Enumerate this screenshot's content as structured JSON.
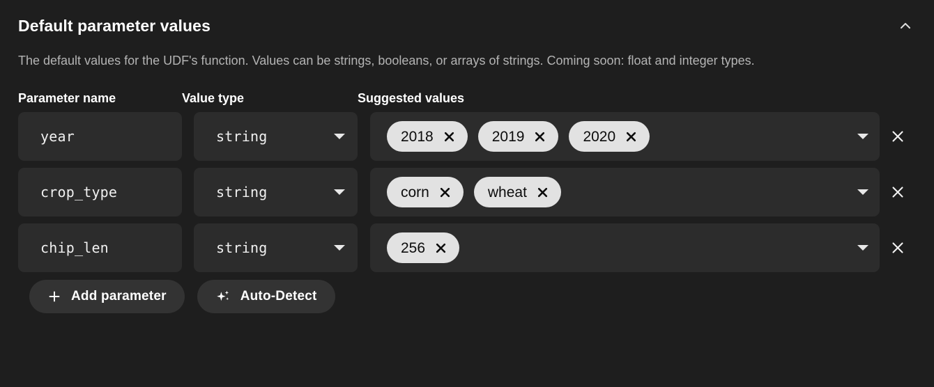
{
  "panel": {
    "title": "Default parameter values",
    "description": "The default values for the UDF's function. Values can be strings, booleans, or arrays of strings. Coming soon: float and integer types.",
    "collapse_icon": "chevron-up-icon"
  },
  "columns": {
    "parameter_name": "Parameter name",
    "value_type": "Value type",
    "suggested_values": "Suggested values"
  },
  "rows": [
    {
      "name": "year",
      "type": "string",
      "values": [
        "2018",
        "2019",
        "2020"
      ]
    },
    {
      "name": "crop_type",
      "type": "string",
      "values": [
        "corn",
        "wheat"
      ]
    },
    {
      "name": "chip_len",
      "type": "string",
      "values": [
        "256"
      ]
    }
  ],
  "actions": {
    "add_parameter": "Add parameter",
    "add_parameter_icon": "plus-icon",
    "auto_detect": "Auto-Detect",
    "auto_detect_icon": "sparkles-icon"
  },
  "icons": {
    "chip_remove": "close-icon",
    "row_remove": "close-icon",
    "type_dropdown": "caret-down-icon",
    "values_dropdown": "caret-down-icon"
  },
  "colors": {
    "background": "#1e1e1e",
    "field": "#2c2c2c",
    "chip": "#e2e2e2",
    "chip_text": "#0c0c0c",
    "button": "#333333",
    "muted_text": "#b4b4b4"
  }
}
